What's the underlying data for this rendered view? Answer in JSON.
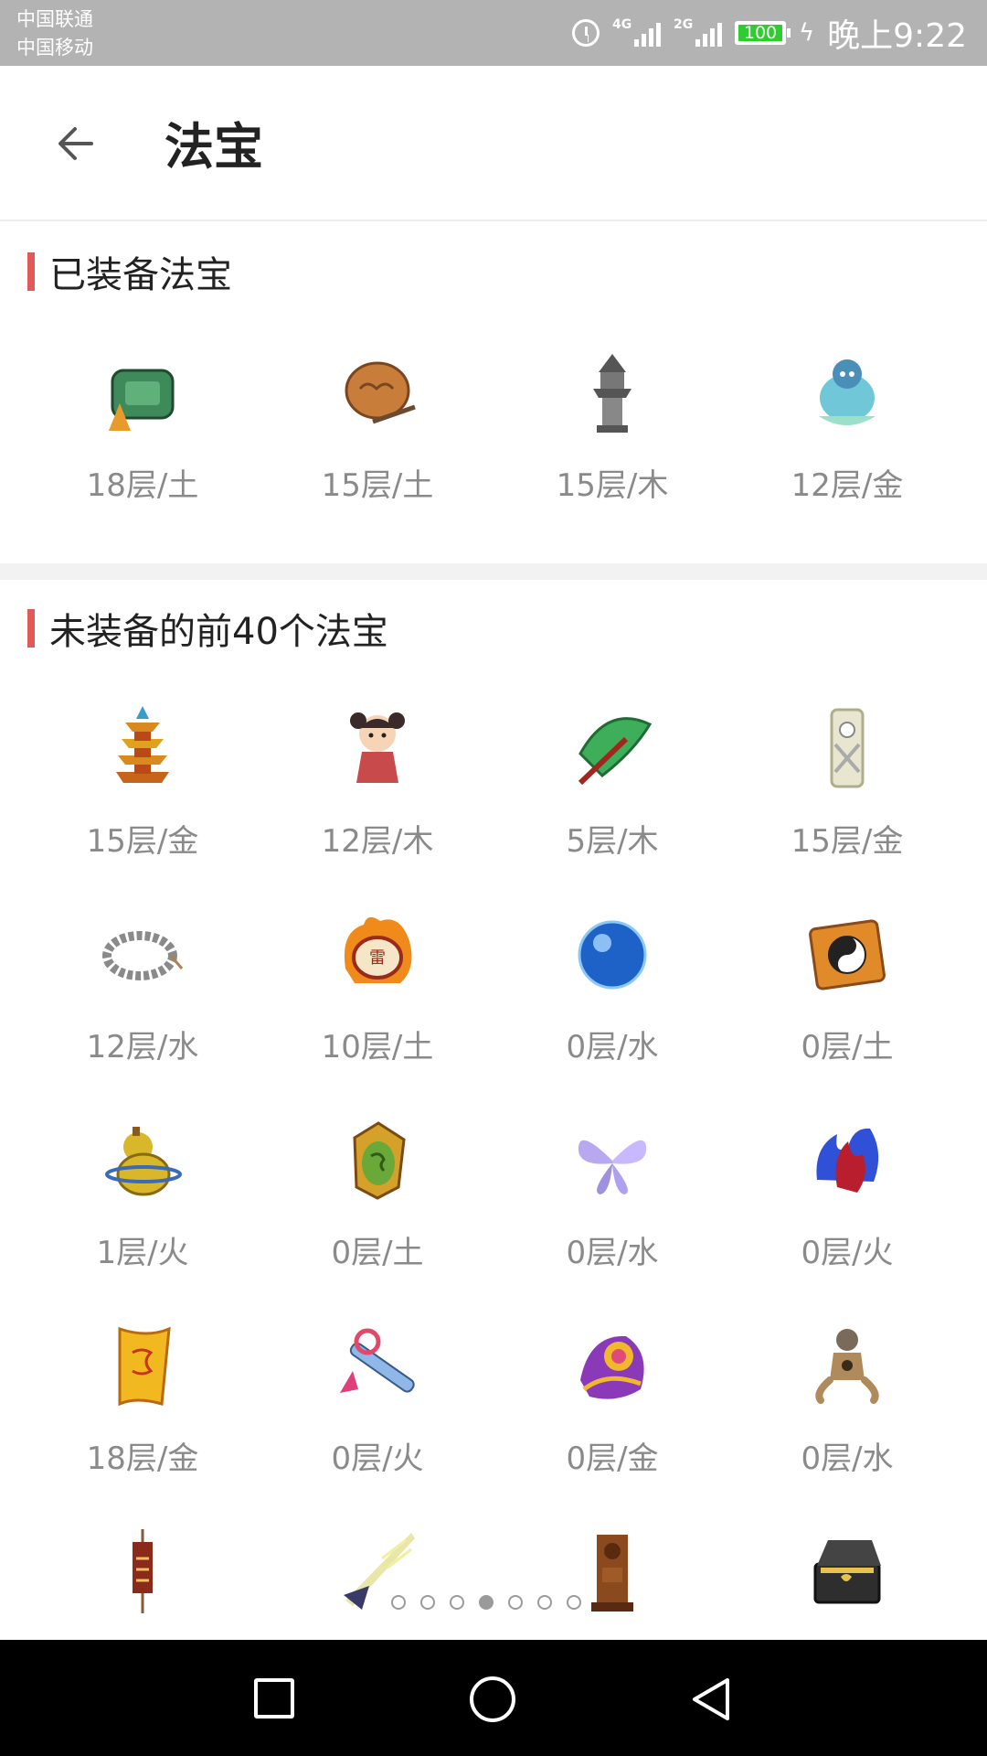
{
  "status_bar": {
    "carrier1": "中国联通",
    "carrier2": "中国移动",
    "net1": "4G",
    "net2": "2G",
    "battery": "100",
    "time": "晚上9:22"
  },
  "header": {
    "title": "法宝"
  },
  "equipped": {
    "title": "已装备法宝",
    "items": [
      {
        "label": "18层/土",
        "icon": "green-jade-pendant-icon"
      },
      {
        "label": "15层/土",
        "icon": "bronze-bowl-icon"
      },
      {
        "label": "15层/木",
        "icon": "stone-pagoda-icon"
      },
      {
        "label": "12层/金",
        "icon": "blue-spirit-icon"
      }
    ]
  },
  "unequipped": {
    "title": "未装备的前40个法宝",
    "items": [
      {
        "label": "15层/金",
        "icon": "golden-pagoda-icon"
      },
      {
        "label": "12层/木",
        "icon": "doll-icon"
      },
      {
        "label": "5层/木",
        "icon": "green-umbrella-icon"
      },
      {
        "label": "15层/金",
        "icon": "white-figure-icon"
      },
      {
        "label": "12层/水",
        "icon": "prayer-beads-icon"
      },
      {
        "label": "10层/土",
        "icon": "flame-drum-icon"
      },
      {
        "label": "0层/水",
        "icon": "blue-orb-icon"
      },
      {
        "label": "0层/土",
        "icon": "yinyang-scroll-icon"
      },
      {
        "label": "1层/火",
        "icon": "gourd-icon"
      },
      {
        "label": "0层/土",
        "icon": "dragon-token-icon"
      },
      {
        "label": "0层/水",
        "icon": "butterfly-icon"
      },
      {
        "label": "0层/火",
        "icon": "red-blue-flame-icon"
      },
      {
        "label": "18层/金",
        "icon": "golden-talisman-icon"
      },
      {
        "label": "0层/火",
        "icon": "jade-flute-icon"
      },
      {
        "label": "0层/金",
        "icon": "ornate-fan-icon"
      },
      {
        "label": "0层/水",
        "icon": "wooden-puppet-icon"
      },
      {
        "label": "",
        "icon": "hanging-banner-icon"
      },
      {
        "label": "",
        "icon": "lightning-blade-icon"
      },
      {
        "label": "",
        "icon": "wooden-totem-icon"
      },
      {
        "label": "",
        "icon": "treasure-chest-icon"
      }
    ]
  },
  "pager": {
    "count": 7,
    "active": 3
  },
  "colors": {
    "accent": "#e05a5a",
    "status_bar": "#b3b3b3",
    "battery": "#2ecc2e",
    "caption": "#8a8a8a"
  }
}
